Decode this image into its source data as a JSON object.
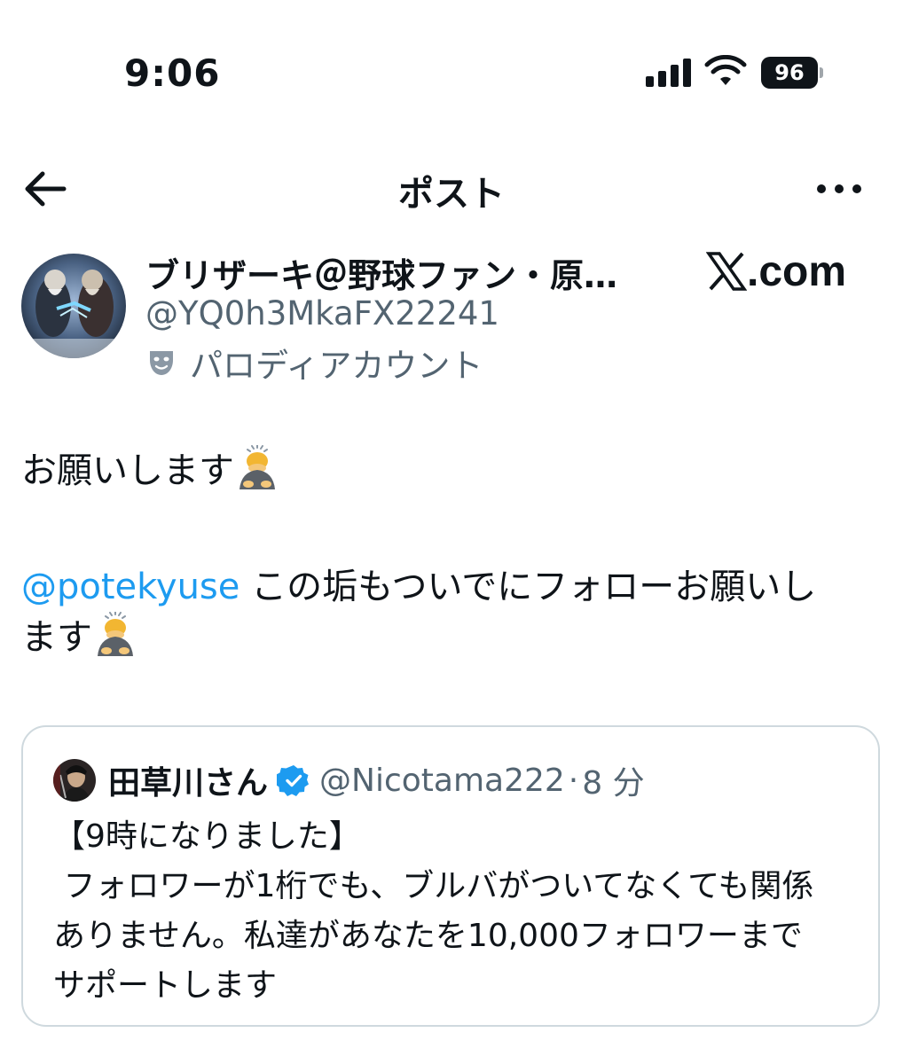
{
  "status_bar": {
    "time": "9:06",
    "battery_level": "96",
    "icons": [
      "signal-icon",
      "wifi-icon",
      "battery-icon"
    ]
  },
  "nav": {
    "title": "ポスト",
    "back_icon": "arrow-left-icon",
    "more_icon": "more-horizontal-icon"
  },
  "author": {
    "name": "ブリザーキ＠野球ファン・原…",
    "handle": "@YQ0h3MkaFX22241",
    "parody_label": "パロディアカウント",
    "parody_icon": "theater-mask-icon"
  },
  "brand": {
    "domain_text": ".com",
    "logo_icon": "x-logo-icon"
  },
  "post": {
    "line1": "お願いします",
    "mention": "@potekyuse",
    "line2_a": " この垢もついでにフォローお願いし",
    "line2_b": "ます",
    "emoji": "bowing-person-emoji"
  },
  "quote": {
    "name": "田草川さん",
    "handle": "@Nicotama222",
    "separator": "·",
    "time": "8 分",
    "verified_icon": "verified-badge-icon",
    "body": "【9時になりました】\n フォロワーが1桁でも、ブルバがついてなくても関係\nありません。私達があなたを10,000フォロワーまで\nサポートします"
  },
  "colors": {
    "text": "#0f1419",
    "secondary": "#536471",
    "link": "#1d9bf0",
    "border": "#cfd9de",
    "verified": "#1d9bf0"
  }
}
